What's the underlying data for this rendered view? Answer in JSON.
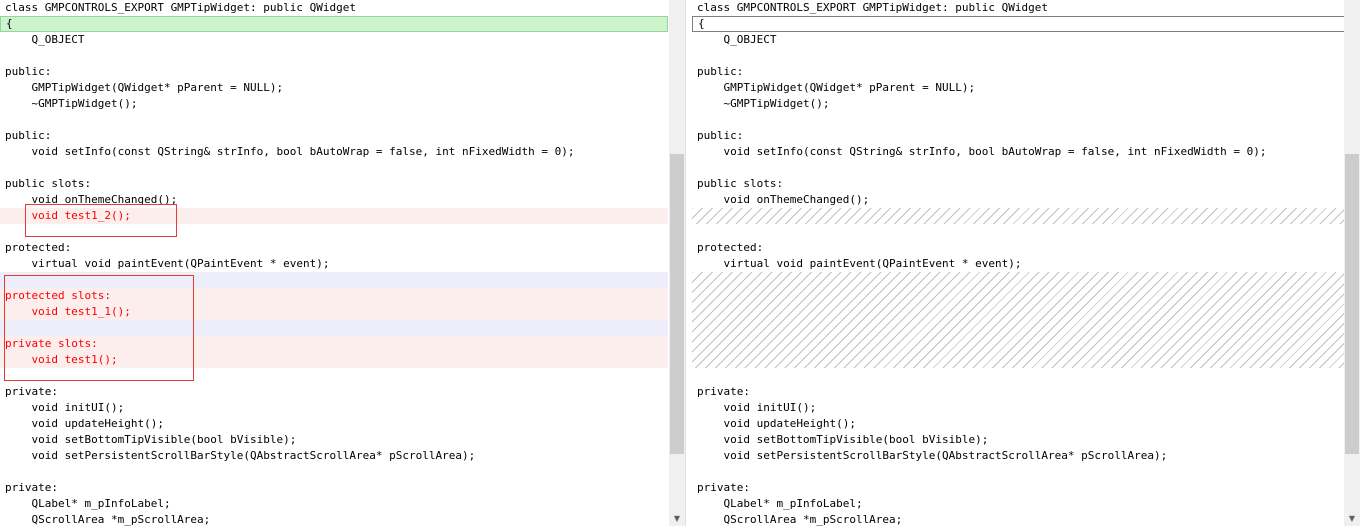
{
  "left": {
    "lines": [
      {
        "text": "class GMPCONTROLS_EXPORT GMPTipWidget: public QWidget",
        "state": "normal"
      },
      {
        "text": "{",
        "state": "current-green"
      },
      {
        "text": "    Q_OBJECT",
        "state": "normal"
      },
      {
        "text": "",
        "state": "normal"
      },
      {
        "text": "public:",
        "state": "normal"
      },
      {
        "text": "    GMPTipWidget(QWidget* pParent = NULL);",
        "state": "normal"
      },
      {
        "text": "    ~GMPTipWidget();",
        "state": "normal"
      },
      {
        "text": "",
        "state": "normal"
      },
      {
        "text": "public:",
        "state": "normal"
      },
      {
        "text": "    void setInfo(const QString& strInfo, bool bAutoWrap = false, int nFixedWidth = 0);",
        "state": "normal"
      },
      {
        "text": "",
        "state": "normal"
      },
      {
        "text": "public slots:",
        "state": "normal"
      },
      {
        "text": "    void onThemeChanged();",
        "state": "normal"
      },
      {
        "text": "    void test1_2();",
        "state": "added"
      },
      {
        "text": "",
        "state": "normal"
      },
      {
        "text": "protected:",
        "state": "normal"
      },
      {
        "text": "    virtual void paintEvent(QPaintEvent * event);",
        "state": "normal"
      },
      {
        "text": "",
        "state": "moved"
      },
      {
        "text": "protected slots:",
        "state": "added"
      },
      {
        "text": "    void test1_1();",
        "state": "added"
      },
      {
        "text": "",
        "state": "moved"
      },
      {
        "text": "private slots:",
        "state": "added"
      },
      {
        "text": "    void test1();",
        "state": "added"
      },
      {
        "text": "",
        "state": "normal"
      },
      {
        "text": "private:",
        "state": "normal"
      },
      {
        "text": "    void initUI();",
        "state": "normal"
      },
      {
        "text": "    void updateHeight();",
        "state": "normal"
      },
      {
        "text": "    void setBottomTipVisible(bool bVisible);",
        "state": "normal"
      },
      {
        "text": "    void setPersistentScrollBarStyle(QAbstractScrollArea* pScrollArea);",
        "state": "normal"
      },
      {
        "text": "",
        "state": "normal"
      },
      {
        "text": "private:",
        "state": "normal"
      },
      {
        "text": "    QLabel* m_pInfoLabel;",
        "state": "normal"
      },
      {
        "text": "    QScrollArea *m_pScrollArea;",
        "state": "normal"
      }
    ]
  },
  "right": {
    "lines": [
      {
        "text": "class GMPCONTROLS_EXPORT GMPTipWidget: public QWidget",
        "state": "normal"
      },
      {
        "text": "{",
        "state": "current-box"
      },
      {
        "text": "    Q_OBJECT",
        "state": "normal"
      },
      {
        "text": "",
        "state": "normal"
      },
      {
        "text": "public:",
        "state": "normal"
      },
      {
        "text": "    GMPTipWidget(QWidget* pParent = NULL);",
        "state": "normal"
      },
      {
        "text": "    ~GMPTipWidget();",
        "state": "normal"
      },
      {
        "text": "",
        "state": "normal"
      },
      {
        "text": "public:",
        "state": "normal"
      },
      {
        "text": "    void setInfo(const QString& strInfo, bool bAutoWrap = false, int nFixedWidth = 0);",
        "state": "normal"
      },
      {
        "text": "",
        "state": "normal"
      },
      {
        "text": "public slots:",
        "state": "normal"
      },
      {
        "text": "    void onThemeChanged();",
        "state": "normal"
      },
      {
        "text": "",
        "state": "hatch"
      },
      {
        "text": "",
        "state": "normal"
      },
      {
        "text": "protected:",
        "state": "normal"
      },
      {
        "text": "    virtual void paintEvent(QPaintEvent * event);",
        "state": "normal"
      },
      {
        "text": "",
        "state": "hatch"
      },
      {
        "text": "",
        "state": "hatch"
      },
      {
        "text": "",
        "state": "hatch"
      },
      {
        "text": "",
        "state": "hatch"
      },
      {
        "text": "",
        "state": "hatch"
      },
      {
        "text": "",
        "state": "hatch"
      },
      {
        "text": "",
        "state": "normal"
      },
      {
        "text": "private:",
        "state": "normal"
      },
      {
        "text": "    void initUI();",
        "state": "normal"
      },
      {
        "text": "    void updateHeight();",
        "state": "normal"
      },
      {
        "text": "    void setBottomTipVisible(bool bVisible);",
        "state": "normal"
      },
      {
        "text": "    void setPersistentScrollBarStyle(QAbstractScrollArea* pScrollArea);",
        "state": "normal"
      },
      {
        "text": "",
        "state": "normal"
      },
      {
        "text": "private:",
        "state": "normal"
      },
      {
        "text": "    QLabel* m_pInfoLabel;",
        "state": "normal"
      },
      {
        "text": "    QScrollArea *m_pScrollArea;",
        "state": "normal"
      }
    ]
  },
  "scrollbars": {
    "arrow_down": "▼"
  }
}
